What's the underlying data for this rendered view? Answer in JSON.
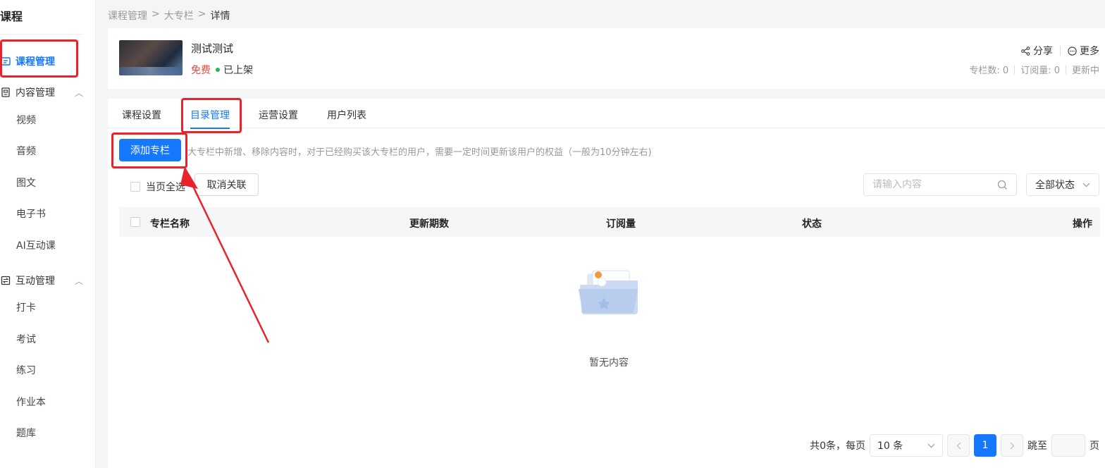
{
  "sidebar": {
    "title": "课程",
    "course_management": "课程管理",
    "content_group": {
      "label": "内容管理",
      "items": [
        "视频",
        "音频",
        "图文",
        "电子书",
        "AI互动课"
      ]
    },
    "interaction_group": {
      "label": "互动管理",
      "items": [
        "打卡",
        "考试",
        "练习",
        "作业本",
        "题库"
      ]
    }
  },
  "breadcrumb": {
    "items": [
      "课程管理",
      "大专栏"
    ],
    "current": "详情",
    "separator": ">"
  },
  "course": {
    "name": "测试测试",
    "price": "免费",
    "status": "已上架",
    "share_label": "分享",
    "more_label": "更多",
    "stats": [
      "专栏数: 0",
      "订阅量: 0",
      "更新中"
    ]
  },
  "tabs": [
    "课程设置",
    "目录管理",
    "运营设置",
    "用户列表"
  ],
  "toolbar": {
    "add_button": "添加专栏",
    "tip": "大专栏中新增、移除内容时，对于已经购买该大专栏的用户，需要一定时间更新该用户的权益（一般为10分钟左右)",
    "select_all": "当页全选",
    "unlink_button": "取消关联",
    "search_placeholder": "请输入内容",
    "status_filter": "全部状态"
  },
  "table": {
    "columns": [
      "专栏名称",
      "更新期数",
      "订阅量",
      "状态",
      "操作"
    ],
    "empty_text": "暂无内容"
  },
  "pagination": {
    "total_label": "共0条，每页",
    "page_size": "10 条",
    "current_page": "1",
    "jump_label": "跳至",
    "page_suffix": "页"
  },
  "colors": {
    "accent": "#1677ff",
    "highlight": "#e8232b",
    "price": "#e8473d",
    "online": "#2bb35a"
  }
}
